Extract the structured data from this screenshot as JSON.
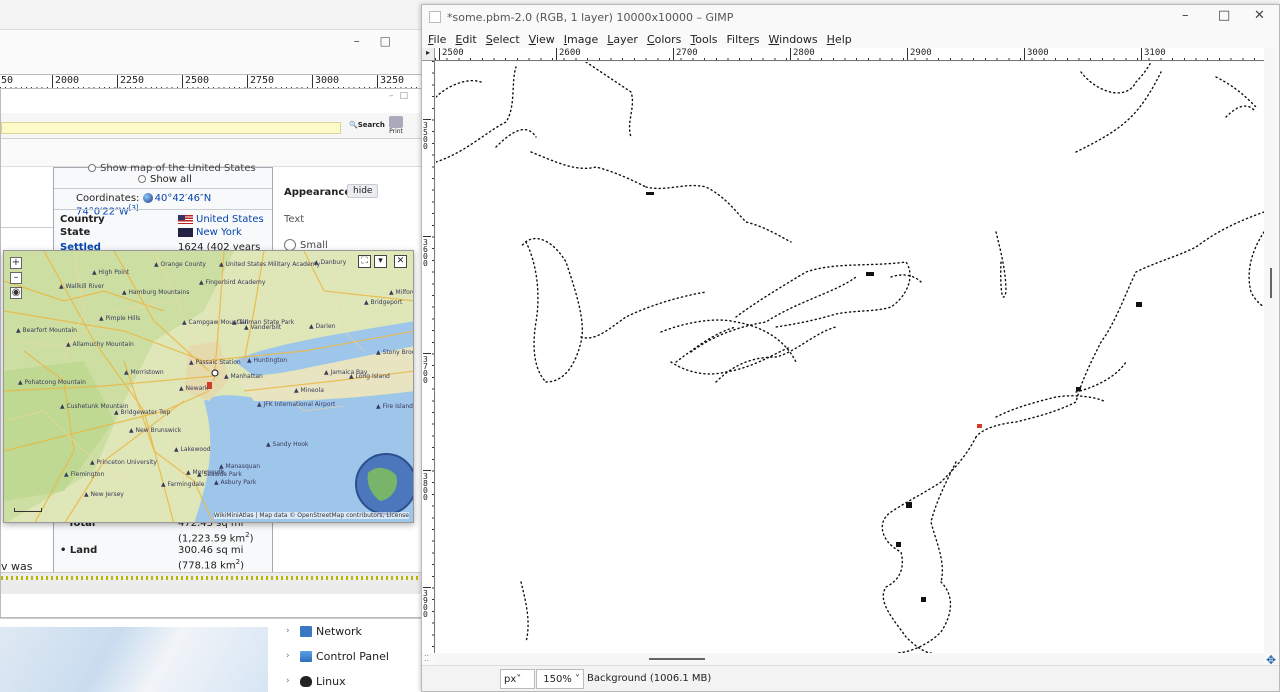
{
  "back_ruler": {
    "labels": [
      "50",
      "2000",
      "2250",
      "2500",
      "2750",
      "3000",
      "3250"
    ]
  },
  "browser": {
    "search_label": "Search",
    "print_label": "Print",
    "left_text": "v was",
    "infobox": {
      "show_map": "Show map of the United States",
      "show_all": "Show all",
      "coordinates_label": "Coordinates:",
      "coordinates_value": "40°42′46″N 74°0′22″W",
      "coordinates_ref": "[3]",
      "country_label": "Country",
      "country_value": "United States",
      "state_label": "State",
      "state_value": "New York",
      "settled_label": "Settled",
      "settled_value": "1624 (402 years",
      "total_label": "Total",
      "total_value": "472.43 sq mi",
      "total_km": "(1,223.59 km",
      "land_label": "• Land",
      "land_value": "300.46 sq mi",
      "land_km": "(778.18 km",
      "sup2": "2",
      "close_paren": ")"
    },
    "appearance": {
      "title": "Appearance",
      "hide": "hide",
      "text": "Text",
      "small": "Small"
    }
  },
  "map": {
    "attribution": "WikiMiniAtlas | Map data © OpenStreetMap contributors, License",
    "labels": [
      "Orange County",
      "High Point",
      "United States Military Academy",
      "Danbury",
      "Wallkill River",
      "Hamburg Mountains",
      "Fingerbird Academy",
      "Milford",
      "Bridgeport",
      "Campgaw Mountain",
      "Pimple Hills",
      "Tallman State Park",
      "Vanderbilt",
      "Darien",
      "Bearfort Mountain",
      "Allamuchy Mountain",
      "Passaic Station",
      "Huntington",
      "Stony Brook University",
      "Morristown",
      "Manhattan",
      "Mineola",
      "Jamaica Bay",
      "Long Island",
      "Pohatcong Mountain",
      "Bridgewater Twp",
      "Newark",
      "JFK International Airport",
      "Fire Island",
      "Cushetunk Mountain",
      "New Brunswick",
      "Princeton University",
      "Lakewood",
      "Manasquan",
      "Monmouth",
      "Seaside Park",
      "Asbury Park",
      "Flemington",
      "Farmingdale",
      "New Jersey",
      "Sandy Hook"
    ]
  },
  "explorer": {
    "items": [
      {
        "label": "Network",
        "icon": "network-icon"
      },
      {
        "label": "Control Panel",
        "icon": "control-panel-icon"
      },
      {
        "label": "Linux",
        "icon": "linux-icon"
      }
    ]
  },
  "gimp": {
    "title": "*some.pbm-2.0 (RGB, 1 layer) 10000x10000 – GIMP",
    "menu": [
      {
        "label": "File",
        "key": "F"
      },
      {
        "label": "Edit",
        "key": "E"
      },
      {
        "label": "Select",
        "key": "S"
      },
      {
        "label": "View",
        "key": "V"
      },
      {
        "label": "Image",
        "key": "I"
      },
      {
        "label": "Layer",
        "key": "L"
      },
      {
        "label": "Colors",
        "key": "C"
      },
      {
        "label": "Tools",
        "key": "T"
      },
      {
        "label": "Filters",
        "key": "r"
      },
      {
        "label": "Windows",
        "key": "W"
      },
      {
        "label": "Help",
        "key": "H"
      }
    ],
    "ruler_top_labels": [
      "2500",
      "2600",
      "2700",
      "2800",
      "2900",
      "3000",
      "3100"
    ],
    "ruler_left_labels": [
      "3500",
      "3600",
      "3700",
      "3800",
      "3900"
    ],
    "unit": "px",
    "zoom": "150%",
    "status": "Background (1006.1 MB)",
    "colors": {
      "marker": "#d43a2a",
      "coast": "#111111"
    }
  }
}
